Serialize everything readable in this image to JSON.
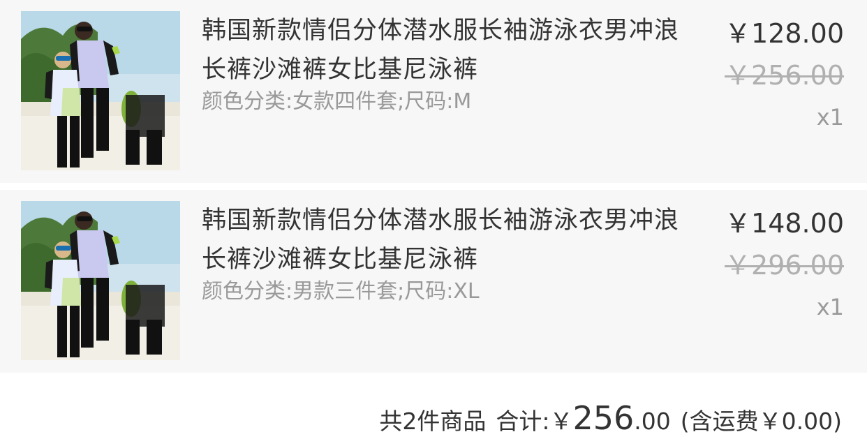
{
  "items": [
    {
      "title": "韩国新款情侣分体潜水服长袖游泳衣男冲浪长裤沙滩裤女比基尼泳裤",
      "sku": "颜色分类:女款四件套;尺码:M",
      "price": "￥128.00",
      "original_price": "￥256.00",
      "quantity": "x1",
      "image_icon": "product-photo"
    },
    {
      "title": "韩国新款情侣分体潜水服长袖游泳衣男冲浪长裤沙滩裤女比基尼泳裤",
      "sku": "颜色分类:男款三件套;尺码:XL",
      "price": "￥148.00",
      "original_price": "￥296.00",
      "quantity": "x1",
      "image_icon": "product-photo"
    }
  ],
  "summary": {
    "count_text": "共2件商品",
    "total_label": "合计:",
    "currency": "￥",
    "total_int": "256",
    "total_dec": ".00",
    "shipping_text": "(含运费￥0.00)"
  },
  "colors": {
    "card_bg": "#f7f7f7",
    "text_primary": "#333333",
    "text_secondary": "#999999",
    "strike": "#b0b0b0"
  }
}
